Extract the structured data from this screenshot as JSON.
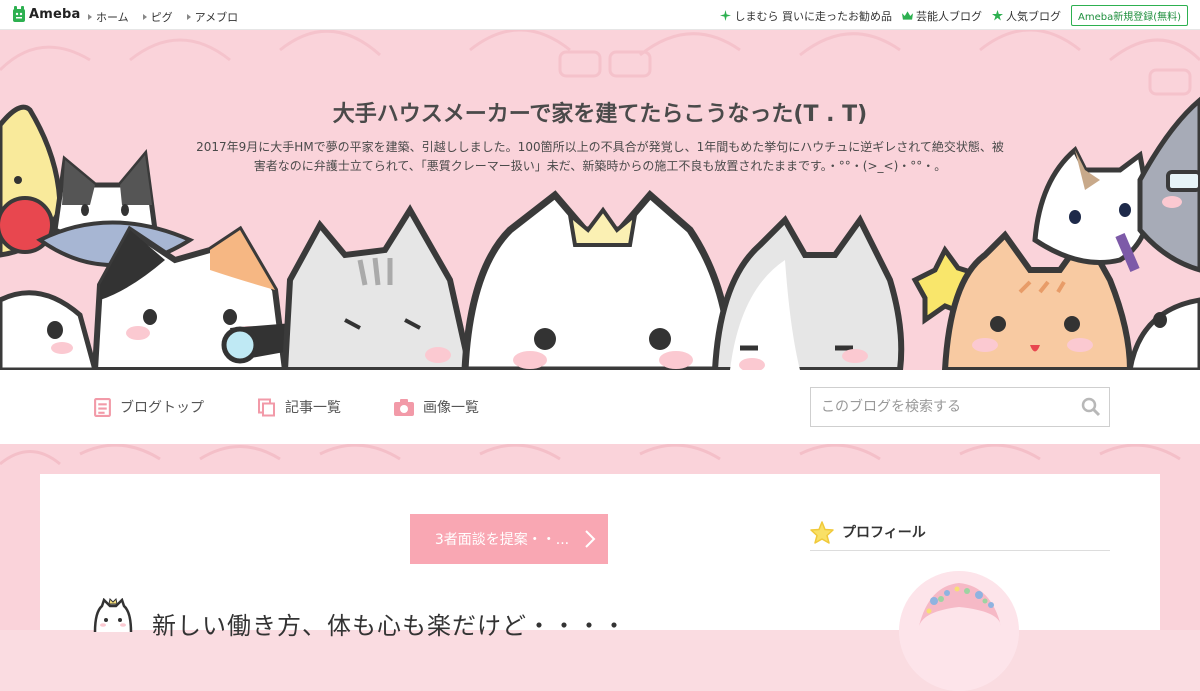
{
  "topbar": {
    "logo_text": "Ameba",
    "nav": [
      {
        "label": "ホーム"
      },
      {
        "label": "ピグ"
      },
      {
        "label": "アメブロ"
      }
    ],
    "links": [
      {
        "label": "しまむら 買いに走ったお勧め品",
        "icon": "sparkle-icon"
      },
      {
        "label": "芸能人ブログ",
        "icon": "crown-icon"
      },
      {
        "label": "人気ブログ",
        "icon": "star-icon"
      }
    ],
    "signup_label": "Ameba新規登録(無料)"
  },
  "header": {
    "title": "大手ハウスメーカーで家を建てたらこうなった(T . T)",
    "description_line1": "2017年9月に大手HMで夢の平家を建築、引越ししました。100箇所以上の不具合が発覚し、1年間もめた挙句にハウチュに逆ギレされて絶交状態、被",
    "description_line2": "害者なのに弁護士立てられて、「悪質クレーマー扱い」未だ、新築時からの施工不良も放置されたままです。・°°・(>_<)・°°・。"
  },
  "navbar": {
    "items": [
      {
        "label": "ブログトップ",
        "icon": "blog-top-icon"
      },
      {
        "label": "記事一覧",
        "icon": "article-list-icon"
      },
      {
        "label": "画像一覧",
        "icon": "camera-icon"
      }
    ],
    "search_placeholder": "このブログを検索する"
  },
  "main": {
    "cta_label": "3者面談を提案・・...",
    "post_title": "新しい働き方、体も心も楽だけど・・・・"
  },
  "sidebar": {
    "profile_heading": "プロフィール"
  },
  "colors": {
    "accent_pink": "#f9a7b3",
    "header_pink": "#fad3da",
    "ameba_green": "#2db050"
  }
}
